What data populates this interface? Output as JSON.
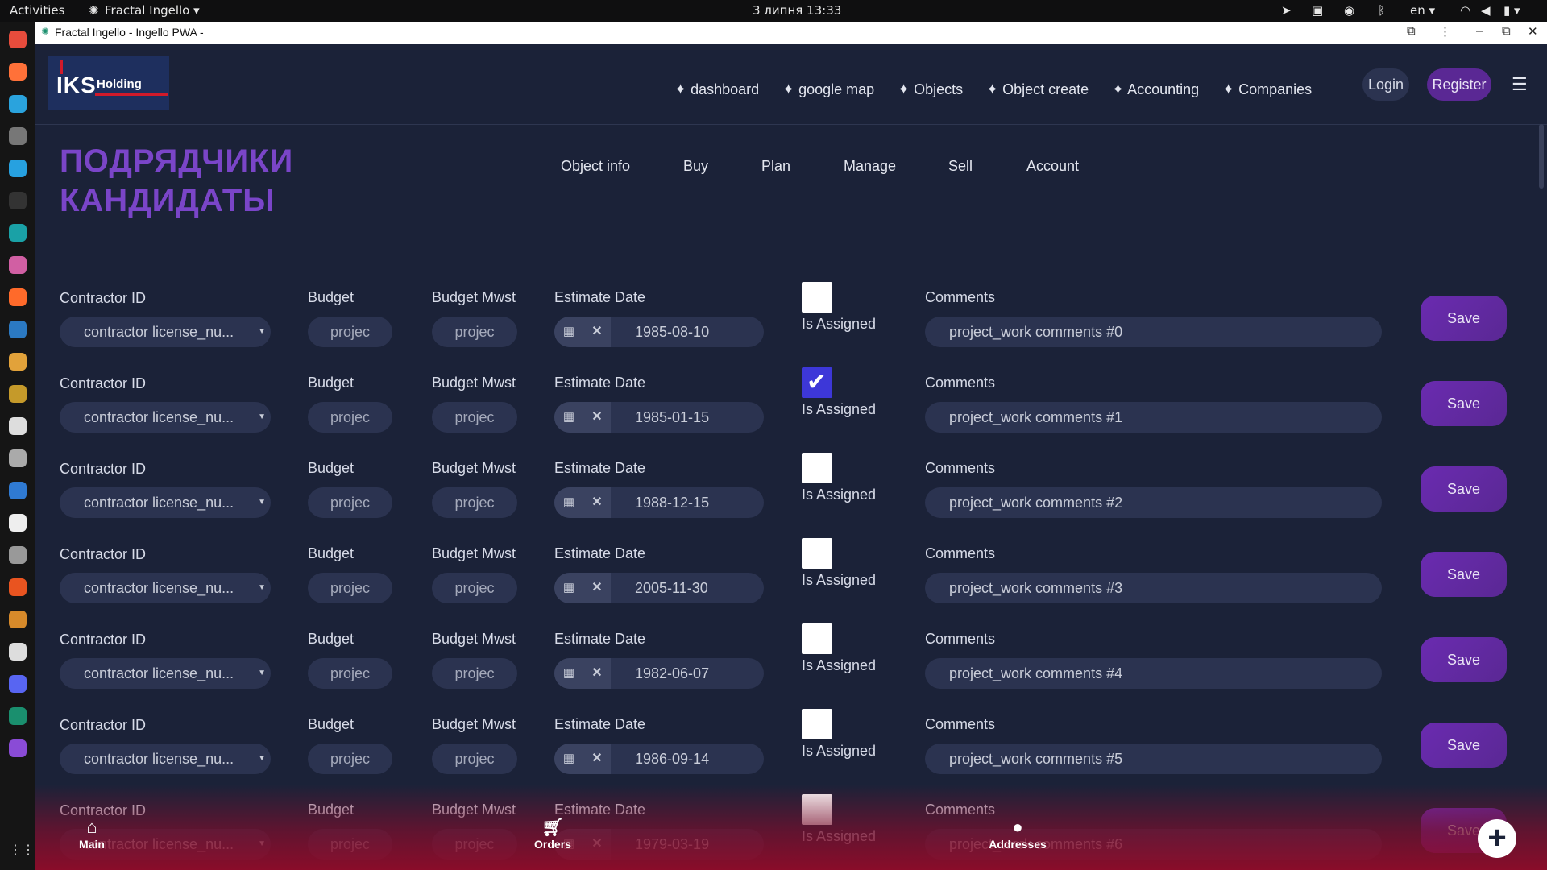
{
  "os_bar": {
    "activities": "Activities",
    "app_name": "Fractal Ingello",
    "clock": "3 липня  13:33",
    "language": "en"
  },
  "browser": {
    "window_title": "Fractal Ingello - Ingello PWA -"
  },
  "header": {
    "logo_main": "IKS",
    "logo_sub": "Holding",
    "nav": [
      "✦ dashboard",
      "✦ google map",
      "✦ Objects",
      "✦ Object create",
      "✦ Accounting",
      "✦ Companies"
    ],
    "login": "Login",
    "register": "Register"
  },
  "page": {
    "title_line1": "ПОДРЯДЧИКИ",
    "title_line2": "КАНДИДАТЫ",
    "tabs": [
      "Object info",
      "Buy",
      "Plan",
      "Manage",
      "Sell",
      "Account"
    ]
  },
  "labels": {
    "contractor_id": "Contractor ID",
    "budget": "Budget",
    "budget_mwst": "Budget Mwst",
    "estimate_date": "Estimate Date",
    "is_assigned": "Is Assigned",
    "comments": "Comments",
    "save": "Save"
  },
  "rows": [
    {
      "contractor": "contractor license_nu...",
      "budget": "projec",
      "budget_mwst": "projec",
      "date": "1985-08-10",
      "assigned": false,
      "comment": "project_work comments #0"
    },
    {
      "contractor": "contractor license_nu...",
      "budget": "projec",
      "budget_mwst": "projec",
      "date": "1985-01-15",
      "assigned": true,
      "comment": "project_work comments #1"
    },
    {
      "contractor": "contractor license_nu...",
      "budget": "projec",
      "budget_mwst": "projec",
      "date": "1988-12-15",
      "assigned": false,
      "comment": "project_work comments #2"
    },
    {
      "contractor": "contractor license_nu...",
      "budget": "projec",
      "budget_mwst": "projec",
      "date": "2005-11-30",
      "assigned": false,
      "comment": "project_work comments #3"
    },
    {
      "contractor": "contractor license_nu...",
      "budget": "projec",
      "budget_mwst": "projec",
      "date": "1982-06-07",
      "assigned": false,
      "comment": "project_work comments #4"
    },
    {
      "contractor": "contractor license_nu...",
      "budget": "projec",
      "budget_mwst": "projec",
      "date": "1986-09-14",
      "assigned": false,
      "comment": "project_work comments #5"
    },
    {
      "contractor": "contractor license_nu...",
      "budget": "projec",
      "budget_mwst": "projec",
      "date": "1979-03-19",
      "assigned": false,
      "comment": "project_work comments #6"
    }
  ],
  "bottom_nav": {
    "main": "Main",
    "orders": "Orders",
    "addresses": "Addresses"
  },
  "colors": {
    "background": "#1b2238",
    "title_purple": "#7a45c8",
    "save_purple": "#6a2bb0",
    "checkbox_checked": "#3d37d8",
    "fade_red": "#960a28"
  }
}
